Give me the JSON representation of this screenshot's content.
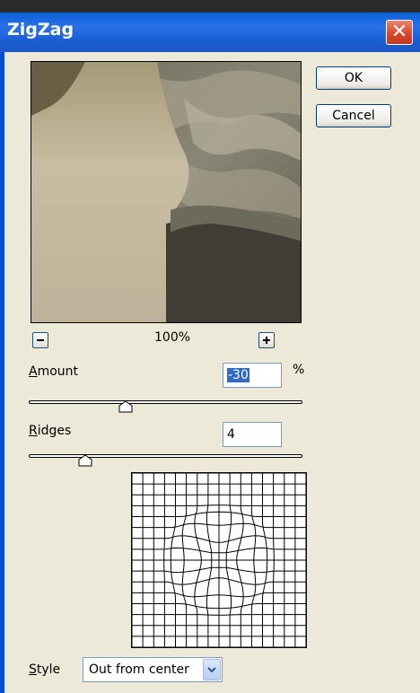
{
  "window": {
    "title": "ZigZag"
  },
  "buttons": {
    "ok": "OK",
    "cancel": "Cancel"
  },
  "zoom": {
    "level": "100%"
  },
  "amount": {
    "label_accel": "A",
    "label_rest": "mount",
    "value": "-30",
    "unit": "%",
    "slider_fraction": 0.35
  },
  "ridges": {
    "label_accel": "R",
    "label_rest": "idges",
    "value": "4",
    "slider_fraction": 0.2
  },
  "style": {
    "label_accel": "S",
    "label_rest": "tyle",
    "selected": "Out from center"
  },
  "icons": {
    "close": "close-icon",
    "zoom_out": "minus-icon",
    "zoom_in": "plus-icon",
    "dropdown": "chevron-down-icon"
  },
  "colors": {
    "titlebar": "#1b5fd5",
    "dialog_bg": "#ece9d8",
    "close_button": "#d6452a",
    "selection": "#316ac5"
  }
}
